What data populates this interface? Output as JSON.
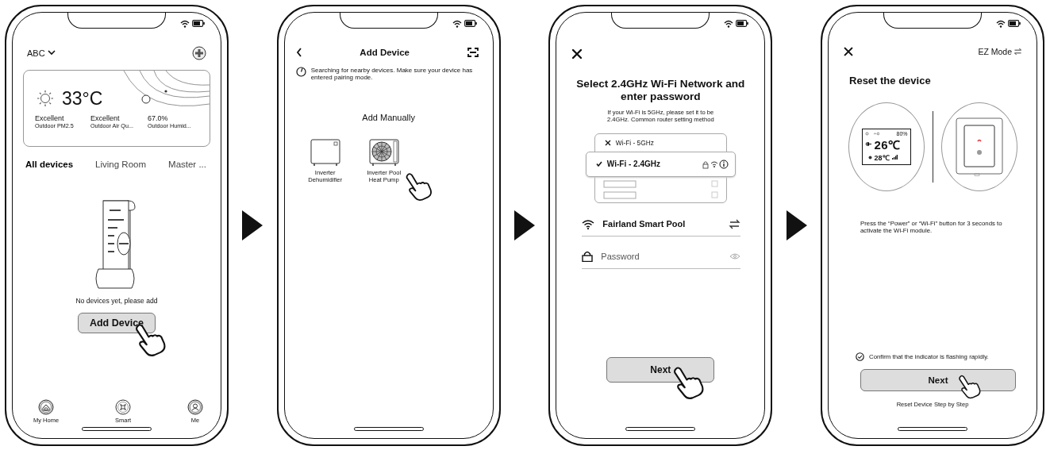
{
  "screens": [
    {
      "kind": "home",
      "home_name": "ABC",
      "weather": {
        "temperature": "33°C",
        "stats": [
          {
            "value": "Excellent",
            "label": "Outdoor PM2.5"
          },
          {
            "value": "Excellent",
            "label": "Outdoor Air Qu..."
          },
          {
            "value": "67.0%",
            "label": "Outdoor Humid..."
          }
        ]
      },
      "rooms": [
        {
          "label": "All devices",
          "selected": true
        },
        {
          "label": "Living Room",
          "selected": false
        },
        {
          "label": "Master ...",
          "selected": false
        }
      ],
      "empty_message": "No devices yet, please add",
      "add_button": "Add Device",
      "nav": [
        {
          "label": "My Home",
          "kind": "home"
        },
        {
          "label": "Smart",
          "kind": "smart"
        },
        {
          "label": "Me",
          "kind": "me"
        }
      ]
    },
    {
      "kind": "add_device",
      "title": "Add Device",
      "notice": "Searching for nearby devices. Make sure your device has entered pairing mode.",
      "section": "Add Manually",
      "devices": [
        {
          "name": "Inverter Dehumidifier",
          "kind": "dehumidifier"
        },
        {
          "name": "Inverter Pool Heat Pump",
          "kind": "heat_pump"
        }
      ]
    },
    {
      "kind": "wifi",
      "title": "Select 2.4GHz Wi-Fi Network and enter password",
      "hint": "If your Wi-Fi is 5GHz, please set it to be 2.4GHz. Common router setting method",
      "networks": [
        {
          "name": "Wi-Fi - 5GHz",
          "selected": false
        },
        {
          "name": "Wi-Fi - 2.4GHz",
          "selected": true
        }
      ],
      "ssid": "Fairland Smart Pool",
      "password_placeholder": "Password",
      "next_button": "Next"
    },
    {
      "kind": "reset",
      "mode_link": "EZ Mode",
      "title": "Reset the device",
      "lcd": {
        "battery": "80%",
        "main": "26℃",
        "sub": "28℃"
      },
      "instruction": "Press the “Power” or “Wi-Fi” button for 3 seconds to activate the Wi-Fi module.",
      "confirm": {
        "label": "Confirm that the indicator is flashing rapidly.",
        "checked": true
      },
      "next_button": "Next",
      "help_link": "Reset Device Step by Step"
    }
  ]
}
